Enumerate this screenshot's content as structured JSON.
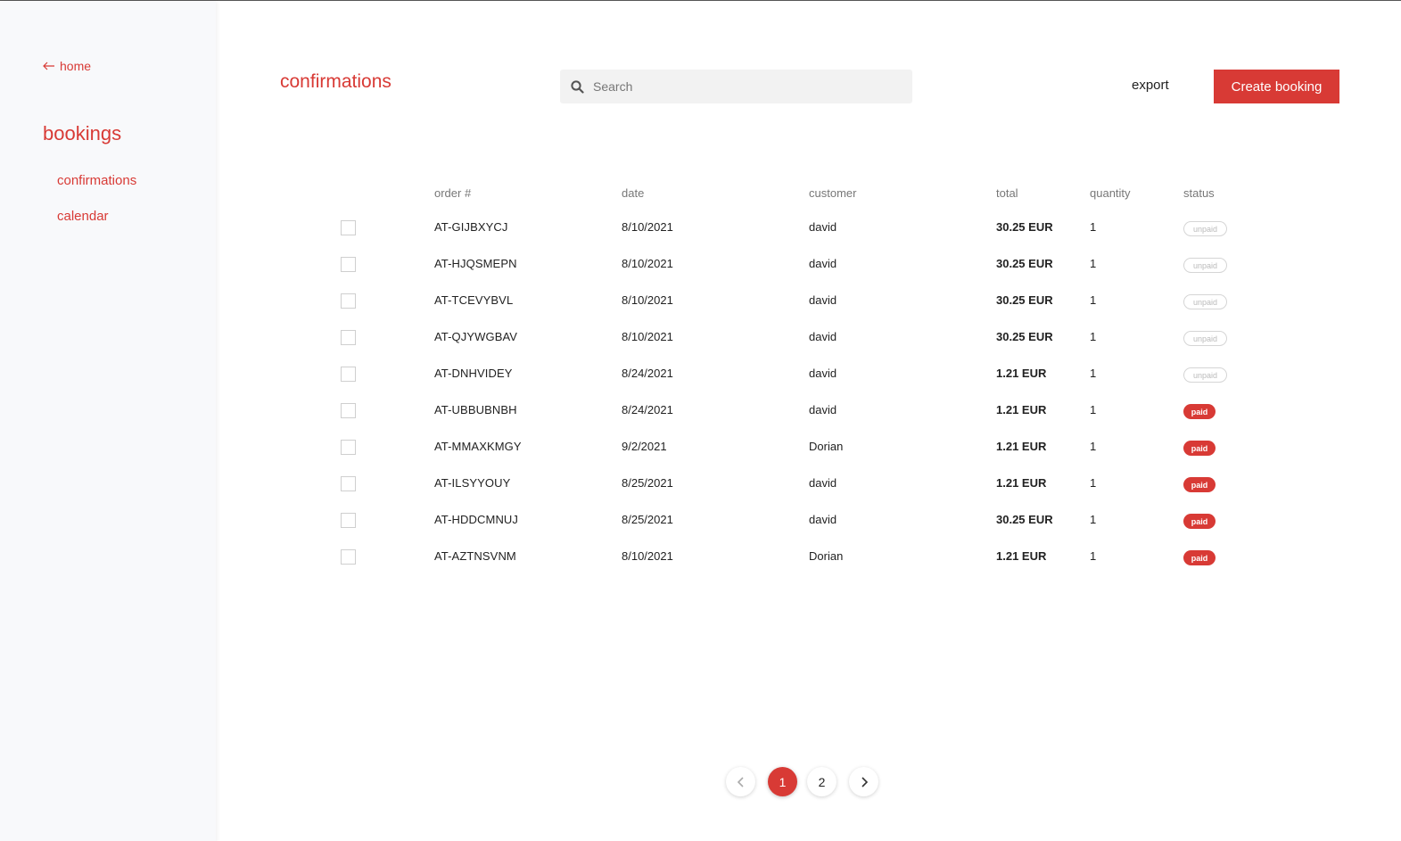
{
  "sidebar": {
    "home_label": "home",
    "section_title": "bookings",
    "items": [
      {
        "label": "confirmations"
      },
      {
        "label": "calendar"
      }
    ]
  },
  "header": {
    "title": "confirmations",
    "search_placeholder": "Search",
    "export_label": "export",
    "create_label": "Create booking"
  },
  "table": {
    "columns": {
      "order": "order #",
      "date": "date",
      "customer": "customer",
      "total": "total",
      "quantity": "quantity",
      "status": "status"
    },
    "rows": [
      {
        "order": "AT-GIJBXYCJ",
        "date": "8/10/2021",
        "customer": "david",
        "total": "30.25 EUR",
        "quantity": "1",
        "status": "unpaid"
      },
      {
        "order": "AT-HJQSMEPN",
        "date": "8/10/2021",
        "customer": "david",
        "total": "30.25 EUR",
        "quantity": "1",
        "status": "unpaid"
      },
      {
        "order": "AT-TCEVYBVL",
        "date": "8/10/2021",
        "customer": "david",
        "total": "30.25 EUR",
        "quantity": "1",
        "status": "unpaid"
      },
      {
        "order": "AT-QJYWGBAV",
        "date": "8/10/2021",
        "customer": "david",
        "total": "30.25 EUR",
        "quantity": "1",
        "status": "unpaid"
      },
      {
        "order": "AT-DNHVIDEY",
        "date": "8/24/2021",
        "customer": "david",
        "total": "1.21 EUR",
        "quantity": "1",
        "status": "unpaid"
      },
      {
        "order": "AT-UBBUBNBH",
        "date": "8/24/2021",
        "customer": "david",
        "total": "1.21 EUR",
        "quantity": "1",
        "status": "paid"
      },
      {
        "order": "AT-MMAXKMGY",
        "date": "9/2/2021",
        "customer": "Dorian",
        "total": "1.21 EUR",
        "quantity": "1",
        "status": "paid"
      },
      {
        "order": "AT-ILSYYOUY",
        "date": "8/25/2021",
        "customer": "david",
        "total": "1.21 EUR",
        "quantity": "1",
        "status": "paid"
      },
      {
        "order": "AT-HDDCMNUJ",
        "date": "8/25/2021",
        "customer": "david",
        "total": "30.25 EUR",
        "quantity": "1",
        "status": "paid"
      },
      {
        "order": "AT-AZTNSVNM",
        "date": "8/10/2021",
        "customer": "Dorian",
        "total": "1.21 EUR",
        "quantity": "1",
        "status": "paid"
      }
    ]
  },
  "pagination": {
    "pages": [
      "1",
      "2"
    ],
    "current": "1"
  },
  "colors": {
    "accent": "#d83a35",
    "sidebar_bg": "#f8f9fb"
  },
  "icons": {
    "back": "arrow-left-icon",
    "search": "search-icon",
    "prev": "chevron-left-icon",
    "next": "chevron-right-icon"
  }
}
